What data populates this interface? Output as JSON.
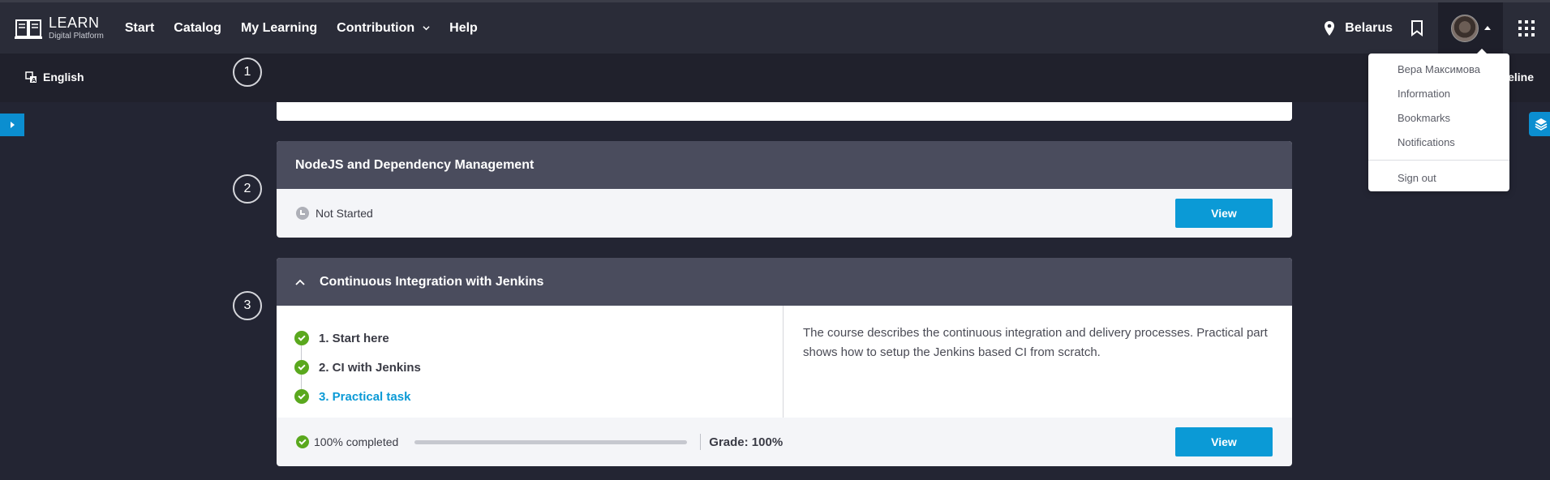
{
  "header": {
    "logo_title": "LEARN",
    "logo_subtitle": "Digital Platform",
    "nav": [
      {
        "label": "Start"
      },
      {
        "label": "Catalog"
      },
      {
        "label": "My Learning"
      },
      {
        "label": "Contribution"
      },
      {
        "label": "Help"
      }
    ],
    "location": "Belarus"
  },
  "subbar": {
    "language": "English",
    "right_text": "eline"
  },
  "user_menu": {
    "name": "Вера Максимова",
    "items": [
      "Information",
      "Bookmarks",
      "Notifications"
    ],
    "sign_out": "Sign out"
  },
  "steps": [
    "1",
    "2",
    "3"
  ],
  "modules": [
    {
      "title": "NodeJS and Dependency Management",
      "status": "Not Started",
      "button": "View"
    },
    {
      "title": "Continuous Integration with Jenkins",
      "lessons": [
        {
          "label": "1. Start here",
          "state": "done"
        },
        {
          "label": "2. CI with Jenkins",
          "state": "done"
        },
        {
          "label": "3. Practical task",
          "state": "active"
        }
      ],
      "description": "The course describes the continuous integration and delivery processes. Practical part shows how to setup the Jenkins based CI from scratch.",
      "completion": "100% completed",
      "progress": 1.0,
      "grade": "Grade: 100%",
      "button": "View"
    }
  ],
  "colors": {
    "accent": "#0b9ad6",
    "success": "#5aa81e",
    "header_bg": "#2a2c38",
    "module_head": "#4a4c5d"
  }
}
